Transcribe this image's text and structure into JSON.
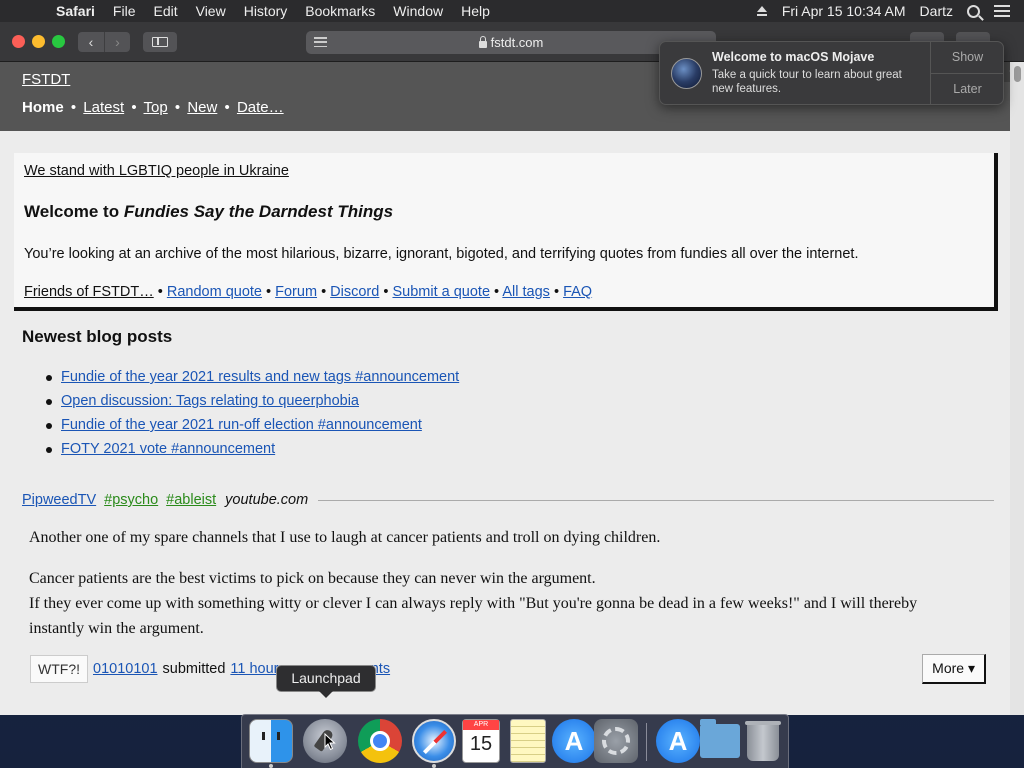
{
  "menubar": {
    "app": "Safari",
    "items": [
      "File",
      "Edit",
      "View",
      "History",
      "Bookmarks",
      "Window",
      "Help"
    ],
    "clock": "Fri Apr 15  10:34 AM",
    "user": "Dartz"
  },
  "browser": {
    "url": "fstdt.com"
  },
  "notification": {
    "title": "Welcome to macOS Mojave",
    "body": "Take a quick tour to learn about great new features.",
    "show_label": "Show",
    "later_label": "Later"
  },
  "site": {
    "title": "FSTDT",
    "nav": {
      "home": "Home",
      "latest": "Latest",
      "top": "Top",
      "new": "New",
      "date": "Date…"
    },
    "nav_separator": "•"
  },
  "intro": {
    "ukraine": "We stand with LGBTIQ people in Ukraine",
    "welcome_prefix": "Welcome to ",
    "welcome_italic": "Fundies Say the Darndest Things",
    "description": "You’re looking at an archive of the most hilarious, bizarre, ignorant, bigoted, and terrifying quotes from fundies all over the internet.",
    "links": {
      "friends": "Friends of FSTDT…",
      "random": "Random quote",
      "forum": "Forum",
      "discord": "Discord",
      "submit": "Submit a quote",
      "tags": "All tags",
      "faq": "FAQ"
    }
  },
  "blog": {
    "title": "Newest blog posts",
    "posts": [
      "Fundie of the year 2021 results and new tags #announcement",
      "Open discussion: Tags relating to queerphobia",
      "Fundie of the year 2021 run-off election #announcement",
      "FOTY 2021 vote #announcement"
    ]
  },
  "quote": {
    "author": "PipweedTV",
    "tags": [
      "#psycho",
      "#ableist"
    ],
    "source": "youtube.com",
    "paragraphs": [
      "Another one of my spare channels that I use to laugh at cancer patients and troll on dying children.",
      "Cancer patients are the best victims to pick on because they can never win the argument.\nIf they ever come up with something witty or clever I can always reply with \"But you're gonna be dead in a few weeks!\" and I will thereby instantly win the argument."
    ],
    "wtf_label": "WTF?!",
    "submitter": "01010101",
    "submitted_text": "submitted",
    "time": "11 hour",
    "comments_link": "mments",
    "more_label": "More ▾"
  },
  "dock": {
    "tooltip": "Launchpad",
    "calendar_month": "APR",
    "calendar_day": "15",
    "apps": [
      "Finder",
      "Launchpad",
      "Google Chrome",
      "Safari",
      "Calendar",
      "Notes",
      "App Store",
      "System Preferences",
      "App Store",
      "Downloads",
      "Trash"
    ]
  },
  "colors": {
    "link": "#1a55b5",
    "tag": "#2a8a1a",
    "header_bg": "#555555"
  }
}
